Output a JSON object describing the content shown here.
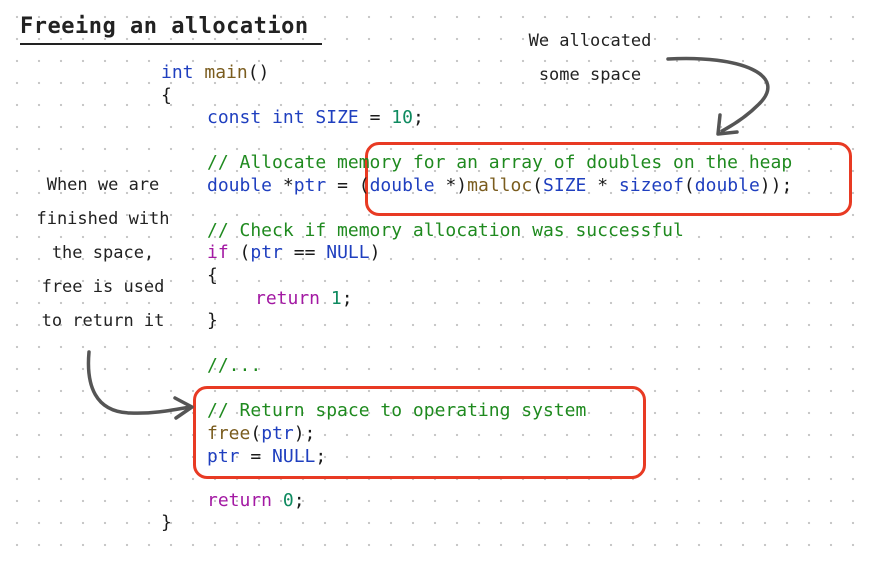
{
  "title": "Freeing an allocation",
  "notes": {
    "allocated": [
      "We allocated",
      "some space"
    ],
    "finished": [
      "When we are",
      "finished with",
      "the space,",
      "free is used",
      "to return it"
    ]
  },
  "code": {
    "l1": [
      "int",
      " ",
      "main",
      "()"
    ],
    "l2": "{",
    "l3": [
      "const",
      " ",
      "int",
      " ",
      "SIZE",
      " = ",
      "10",
      ";"
    ],
    "l4": "// Allocate memory for an array of doubles on the heap",
    "l5": [
      "double",
      " *",
      "ptr",
      " = (",
      "double",
      " *)",
      "malloc",
      "(",
      "SIZE",
      " * ",
      "sizeof",
      "(",
      "double",
      "));"
    ],
    "l6": "// Check if memory allocation was successful",
    "l7": [
      "if",
      " (",
      "ptr",
      " == ",
      "NULL",
      ")"
    ],
    "l8": "{",
    "l9": [
      "return",
      " ",
      "1",
      ";"
    ],
    "l10": "}",
    "l11": "//...",
    "l12": "// Return space to operating system",
    "l13": [
      "free",
      "(",
      "ptr",
      ");"
    ],
    "l14": [
      "ptr",
      " = ",
      "NULL",
      ";"
    ],
    "l15": [
      "return",
      " ",
      "0",
      ";"
    ],
    "l16": "}"
  },
  "colors": {
    "highlight": "#e83a23",
    "type_keyword": "#1f3fbf",
    "control_keyword": "#a319a3",
    "function": "#7a5c1e",
    "number": "#0e8a5f",
    "comment": "#1f8a1f"
  }
}
